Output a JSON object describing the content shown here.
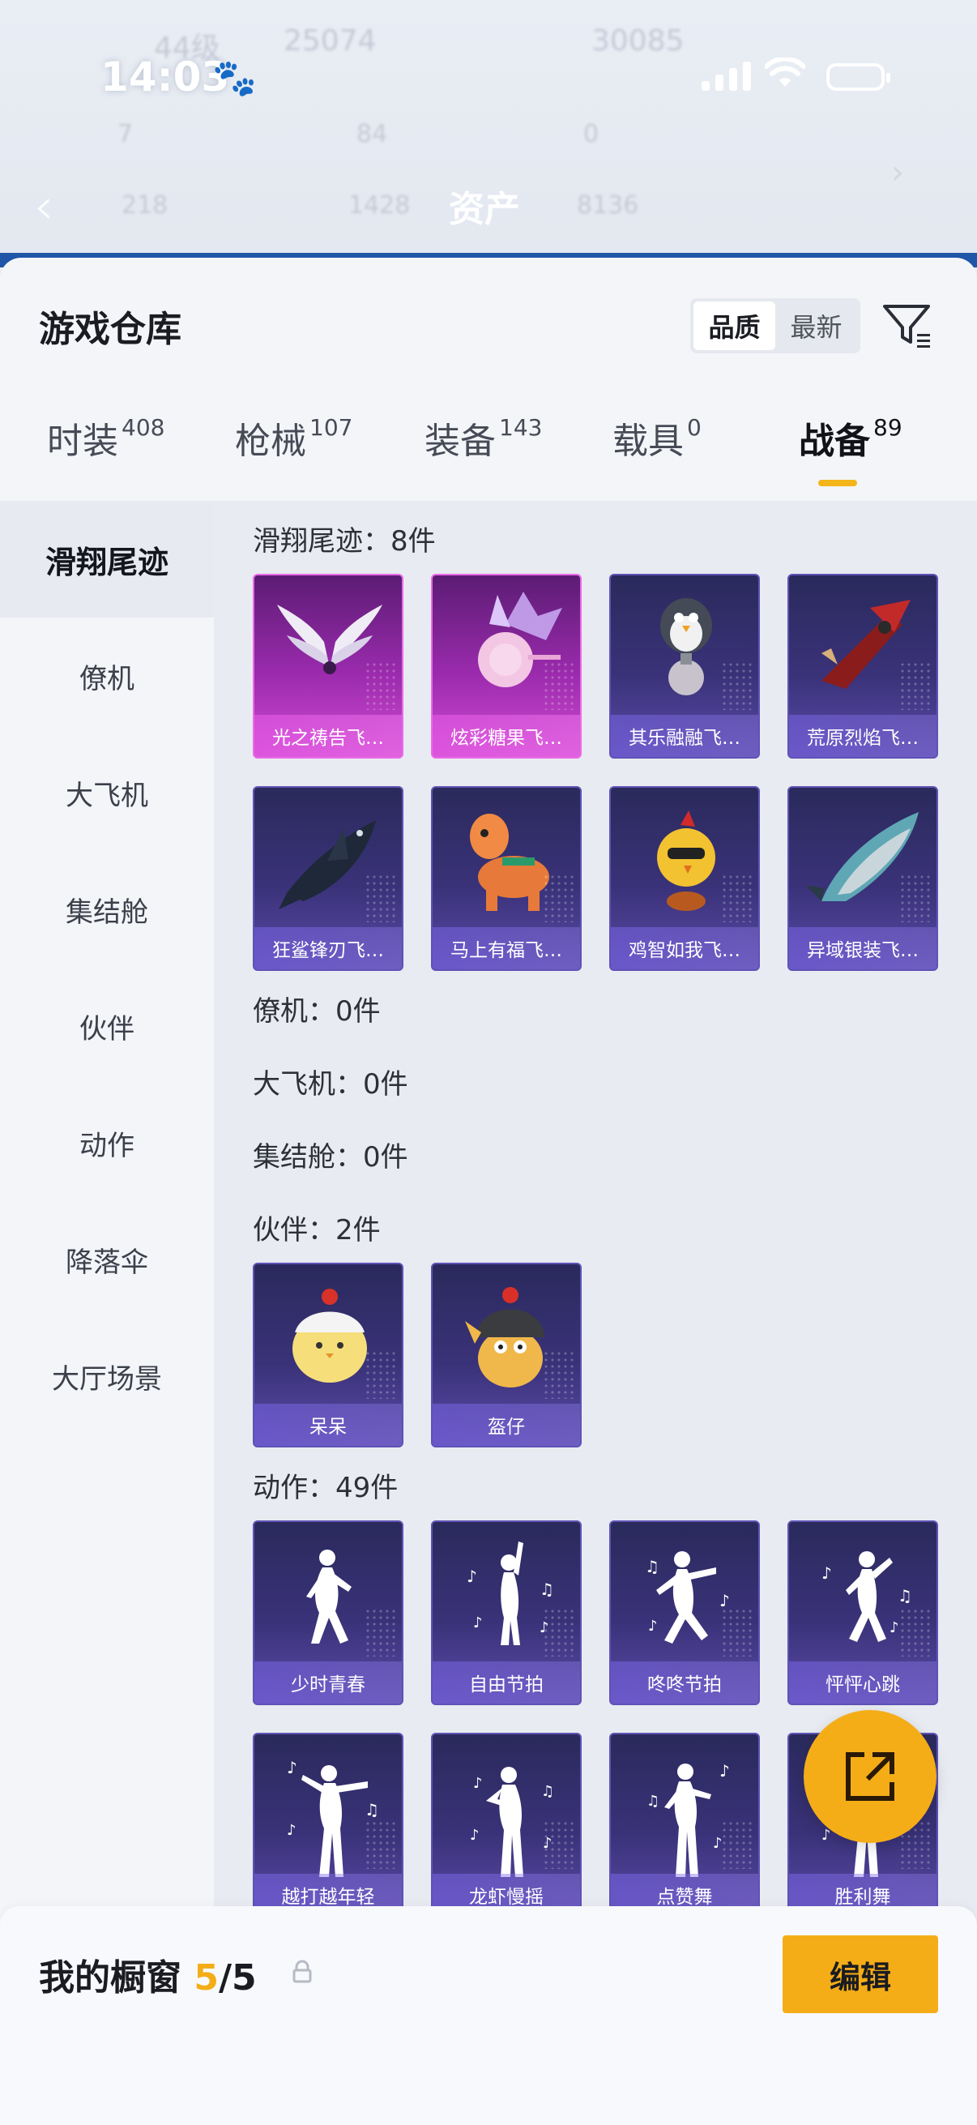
{
  "status_bar": {
    "time": "14:03"
  },
  "background": {
    "level": "44级",
    "count_a": "25074",
    "count_b": "30085",
    "page_title": "资产",
    "stats": [
      "7",
      "84",
      "0",
      "218",
      "1428",
      "8136"
    ]
  },
  "panel": {
    "title": "游戏仓库",
    "sort_options": [
      "品质",
      "最新"
    ],
    "sort_selected": "品质"
  },
  "tabs": [
    {
      "label": "时装",
      "count": "408"
    },
    {
      "label": "枪械",
      "count": "107"
    },
    {
      "label": "装备",
      "count": "143"
    },
    {
      "label": "载具",
      "count": "0"
    },
    {
      "label": "战备",
      "count": "89",
      "active": true
    }
  ],
  "sidebar": [
    {
      "label": "滑翔尾迹",
      "active": true
    },
    {
      "label": "僚机"
    },
    {
      "label": "大飞机"
    },
    {
      "label": "集结舱"
    },
    {
      "label": "伙伴"
    },
    {
      "label": "动作"
    },
    {
      "label": "降落伞"
    },
    {
      "label": "大厅场景"
    }
  ],
  "sections": {
    "glide": {
      "label": "滑翔尾迹：8件",
      "items": [
        "光之祷告飞…",
        "炫彩糖果飞…",
        "其乐融融飞…",
        "荒原烈焰飞…",
        "狂鲨锋刃飞…",
        "马上有福飞…",
        "鸡智如我飞…",
        "异域银装飞…"
      ]
    },
    "wingman": {
      "label": "僚机：0件"
    },
    "plane": {
      "label": "大飞机：0件"
    },
    "pod": {
      "label": "集结舱：0件"
    },
    "partner": {
      "label": "伙伴：2件",
      "items": [
        "呆呆",
        "盔仔"
      ]
    },
    "emote": {
      "label": "动作：49件",
      "items": [
        "少时青春",
        "自由节拍",
        "咚咚节拍",
        "怦怦心跳",
        "越打越年轻",
        "龙虾慢摇",
        "点赞舞",
        "胜利舞"
      ]
    }
  },
  "showcase": {
    "title": "我的橱窗",
    "current": "5",
    "separator": "/",
    "total": "5",
    "edit_label": "编辑"
  },
  "colors": {
    "accent": "#f4ad17",
    "rare_pink": "#d04bd0",
    "card_purple": "#3a3279"
  }
}
